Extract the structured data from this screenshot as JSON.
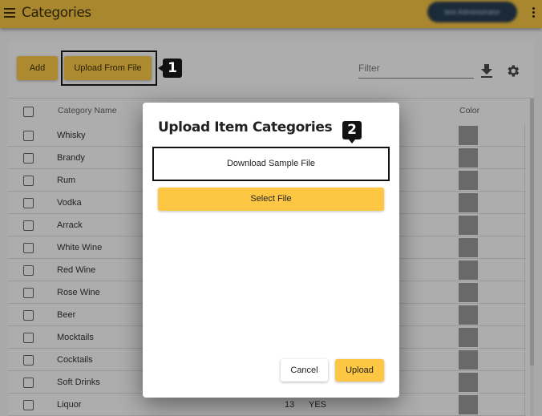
{
  "header": {
    "title": "Categories",
    "user_label": "test Administrator",
    "menu_icon": "hamburger-menu-icon",
    "more_icon": "more-vert-icon"
  },
  "toolbar": {
    "add_label": "Add",
    "upload_from_file_label": "Upload From File",
    "filter_placeholder": "Filter",
    "filter_value": "",
    "download_icon": "download-icon",
    "settings_icon": "gear-icon"
  },
  "annotations": {
    "marker_1": "1",
    "marker_2": "2"
  },
  "table": {
    "columns": {
      "name": "Category Name",
      "color": "Color"
    },
    "rows": [
      {
        "name": "Whisky",
        "swatch_color": "#696969"
      },
      {
        "name": "Brandy",
        "swatch_color": "#696969"
      },
      {
        "name": "Rum",
        "swatch_color": "#696969"
      },
      {
        "name": "Vodka",
        "swatch_color": "#696969"
      },
      {
        "name": "Arrack",
        "swatch_color": "#696969"
      },
      {
        "name": "White Wine",
        "swatch_color": "#696969"
      },
      {
        "name": "Red Wine",
        "swatch_color": "#696969"
      },
      {
        "name": "Rose Wine",
        "swatch_color": "#696969"
      },
      {
        "name": "Beer",
        "swatch_color": "#696969"
      },
      {
        "name": "Mocktails",
        "swatch_color": "#696969"
      },
      {
        "name": "Cocktails",
        "swatch_color": "#696969"
      },
      {
        "name": "Soft Drinks",
        "swatch_color": "#696969"
      },
      {
        "name": "Liquor",
        "number": "13",
        "flag": "YES",
        "swatch_color": "#696969"
      }
    ]
  },
  "dialog": {
    "title": "Upload Item Categories",
    "download_sample_label": "Download Sample File",
    "select_file_label": "Select File",
    "cancel_label": "Cancel",
    "upload_label": "Upload"
  },
  "colors": {
    "header_bg": "#a8872f",
    "accent": "#fdc744",
    "dimmed_accent": "#ad8a2f",
    "user_chip": "#1b2a38"
  }
}
